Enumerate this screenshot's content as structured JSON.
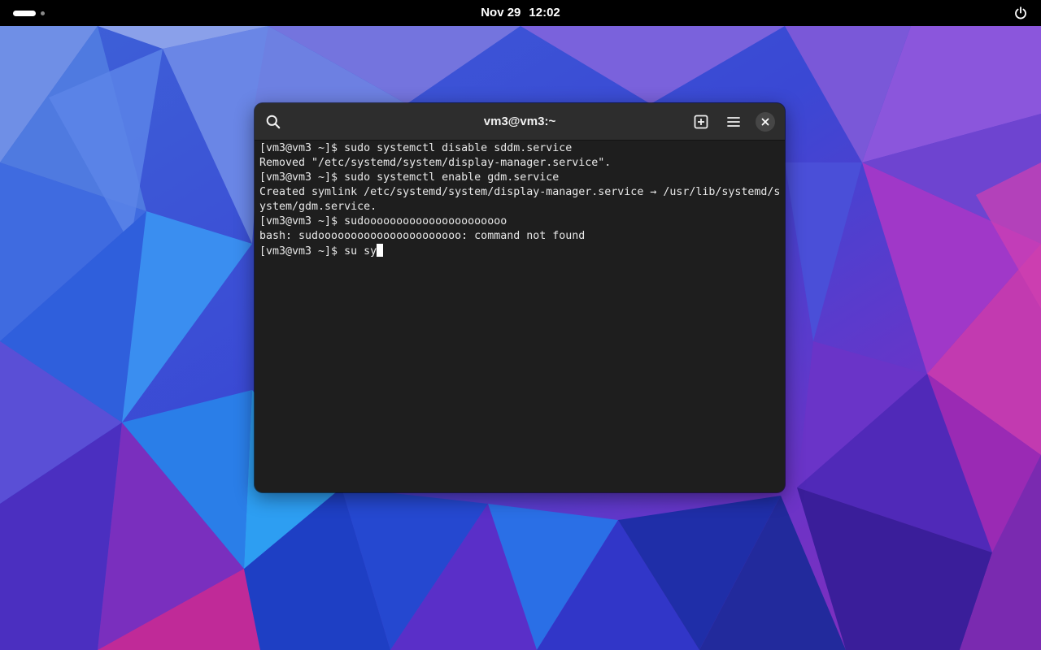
{
  "topbar": {
    "date": "Nov 29",
    "time": "12:02"
  },
  "terminal": {
    "title": "vm3@vm3:~",
    "lines": [
      "[vm3@vm3 ~]$ sudo systemctl disable sddm.service",
      "Removed \"/etc/systemd/system/display-manager.service\".",
      "[vm3@vm3 ~]$ sudo systemctl enable gdm.service",
      "Created symlink /etc/systemd/system/display-manager.service → /usr/lib/systemd/s",
      "ystem/gdm.service.",
      "[vm3@vm3 ~]$ sudoooooooooooooooooooooo",
      "bash: sudoooooooooooooooooooooo: command not found"
    ],
    "current_prompt": "[vm3@vm3 ~]$ su sy"
  },
  "icons": {
    "activities": "workspace-indicator",
    "power": "power-icon",
    "search": "search-icon",
    "new_tab": "new-tab-icon",
    "menu": "hamburger-menu-icon",
    "close": "close-icon"
  },
  "colors": {
    "topbar": "#000000",
    "headerbar": "#2d2d2d",
    "terminal_bg": "#1e1e1e",
    "terminal_fg": "#e8e8e8",
    "wallpaper_base": "#3a3fd0"
  }
}
